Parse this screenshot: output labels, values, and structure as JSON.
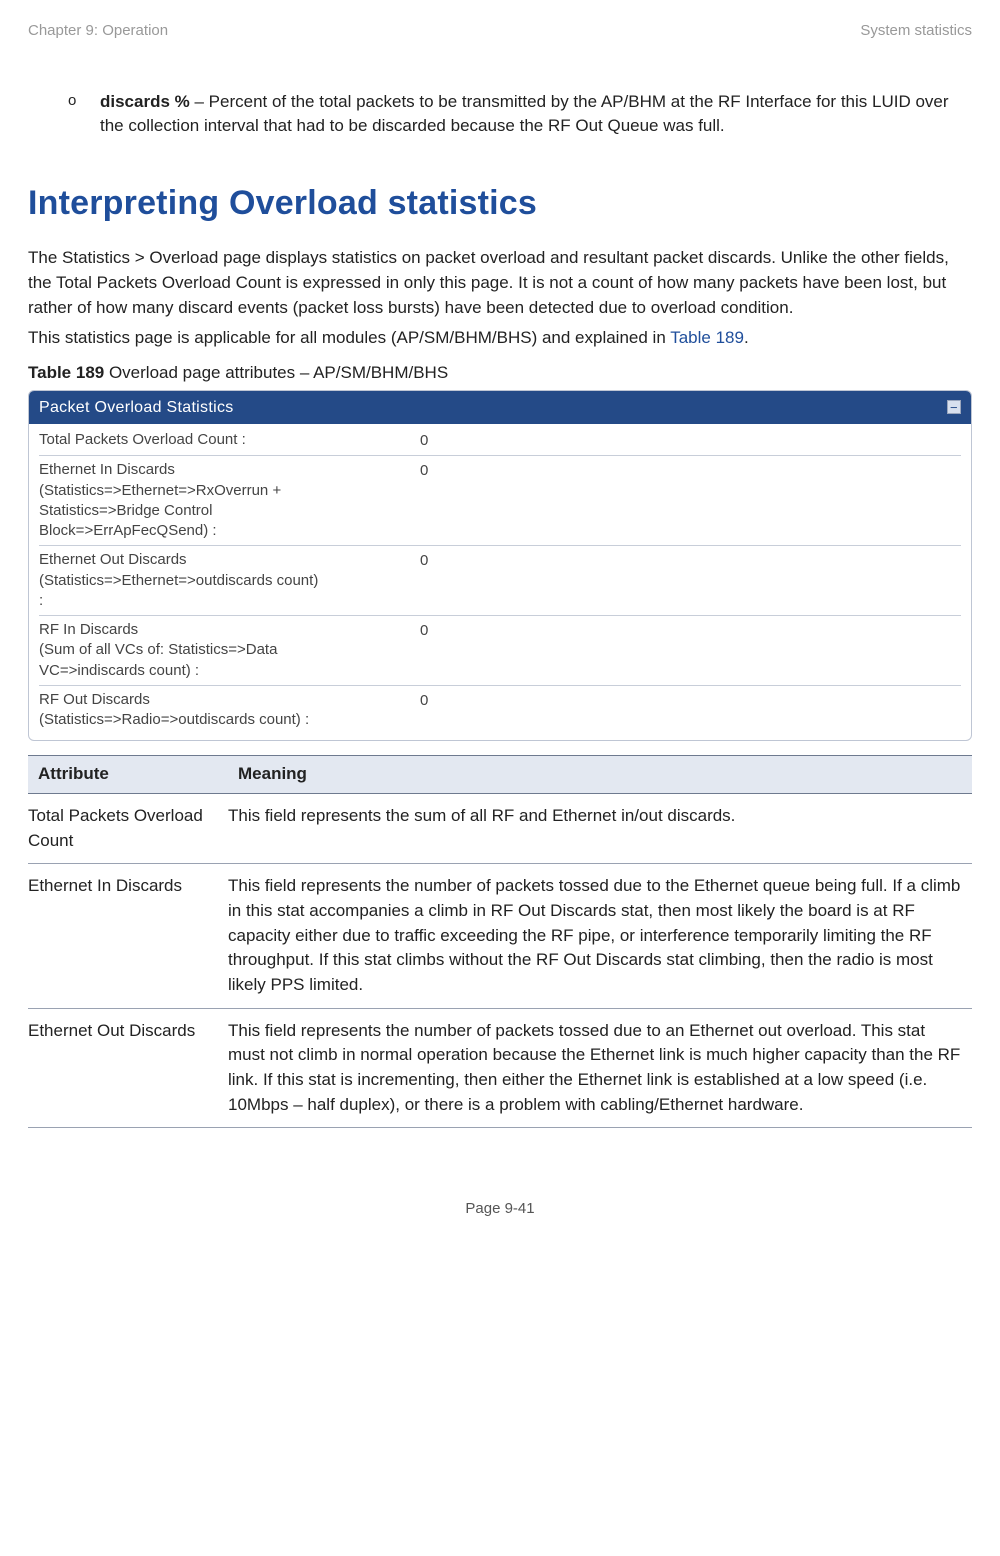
{
  "header": {
    "left": "Chapter 9:  Operation",
    "right": "System statistics"
  },
  "list_item": {
    "marker": "o",
    "bold": "discards %",
    "rest": " – Percent of the total packets to be transmitted by the AP/BHM at the RF Interface for this LUID over the collection interval that had to be discarded because the RF Out Queue was full."
  },
  "section_heading": "Interpreting Overload statistics",
  "para1": "The Statistics > Overload page displays statistics on packet overload and resultant packet discards. Unlike the other fields, the Total Packets Overload Count is expressed in only this page. It is not a count of how many packets have been lost, but rather of how many discard events (packet loss bursts) have been detected due to overload condition.",
  "para2_pre": "This statistics page is applicable for all modules (AP/SM/BHM/BHS) and explained in ",
  "para2_link": "Table 189",
  "para2_post": ".",
  "table_caption_bold": "Table 189",
  "table_caption_rest": " Overload page attributes – AP/SM/BHM/BHS",
  "panel": {
    "title": "Packet Overload Statistics",
    "rows": [
      {
        "label": "Total Packets Overload Count :",
        "value": "0"
      },
      {
        "label": "Ethernet In Discards\n(Statistics=>Ethernet=>RxOverrun +\nStatistics=>Bridge Control\nBlock=>ErrApFecQSend) :",
        "value": "0"
      },
      {
        "label": "Ethernet Out Discards\n(Statistics=>Ethernet=>outdiscards count)\n:",
        "value": "0"
      },
      {
        "label": "RF In Discards\n(Sum of all VCs of: Statistics=>Data\nVC=>indiscards count) :",
        "value": "0"
      },
      {
        "label": "RF Out Discards\n(Statistics=>Radio=>outdiscards count) :",
        "value": "0"
      }
    ]
  },
  "attr_table": {
    "headers": [
      "Attribute",
      "Meaning"
    ],
    "rows": [
      {
        "attr": "Total Packets Overload Count",
        "meaning": "This field represents the sum of all RF and Ethernet in/out discards."
      },
      {
        "attr": "Ethernet In Discards",
        "meaning": "This field represents the number of packets tossed due to the Ethernet queue being full. If a climb in this stat accompanies a climb in RF Out Discards stat, then most likely the board is at RF capacity either due to traffic exceeding the RF pipe, or interference temporarily limiting the RF throughput. If this stat climbs without the RF Out Discards stat climbing, then the radio is most likely PPS limited."
      },
      {
        "attr": "Ethernet Out Discards",
        "meaning": "This field represents the number of packets tossed due to an Ethernet out overload. This stat must not climb in normal operation because the Ethernet link is much higher capacity than the RF link. If this stat is incrementing, then either the Ethernet link is established at a low speed (i.e. 10Mbps – half duplex), or there is a problem with cabling/Ethernet hardware."
      }
    ]
  },
  "footer": "Page 9-41"
}
